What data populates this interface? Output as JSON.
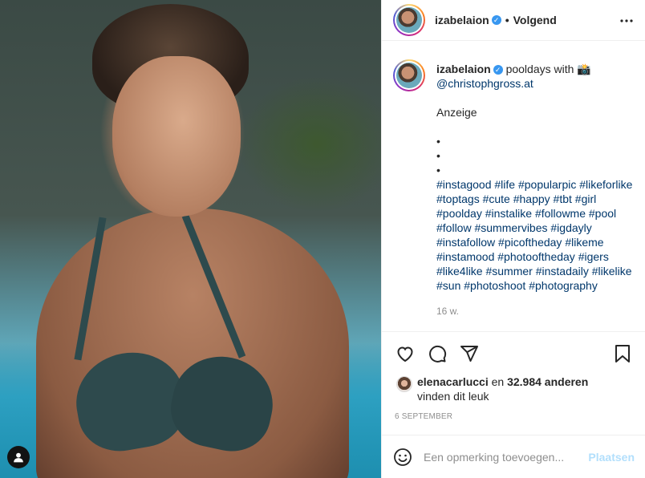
{
  "post": {
    "username": "izabelaion",
    "verified_icon": "verified-badge-icon",
    "follow_status": "Volgend",
    "separator": "•",
    "caption": {
      "text": "pooldays with 📸",
      "mention": "@christophgross.at",
      "ad_label": "Anzeige",
      "bullets": [
        "•",
        "•",
        "•"
      ],
      "hashtags": [
        "#instagood #life #popularpic #likeforlike",
        "#toptags #cute #happy #tbt #girl",
        "#poolday #instalike #followme #pool",
        "#follow #summervibes #igdayly",
        "#instafollow #picoftheday #likeme",
        "#instamood #photooftheday #igers",
        "#like4like #summer #instadaily #likelike",
        "#sun #photoshoot #photography"
      ],
      "age": "16 w."
    },
    "likes": {
      "liker": "elenacarlucci",
      "middle": " en ",
      "others": "32.984 anderen",
      "suffix": "vinden dit leuk"
    },
    "date": "6 SEPTEMBER",
    "comment": {
      "placeholder": "Een opmerking toevoegen...",
      "post_label": "Plaatsen"
    }
  },
  "icons": {
    "more": "more-options-icon",
    "like": "heart-icon",
    "comment": "comment-icon",
    "share": "share-icon",
    "save": "bookmark-icon",
    "emoji": "emoji-icon",
    "tags": "user-tag-icon"
  },
  "colors": {
    "link": "#00376b",
    "verified": "#3897f0",
    "post_button_disabled": "#b2dffc",
    "muted": "#8e8e8e"
  }
}
